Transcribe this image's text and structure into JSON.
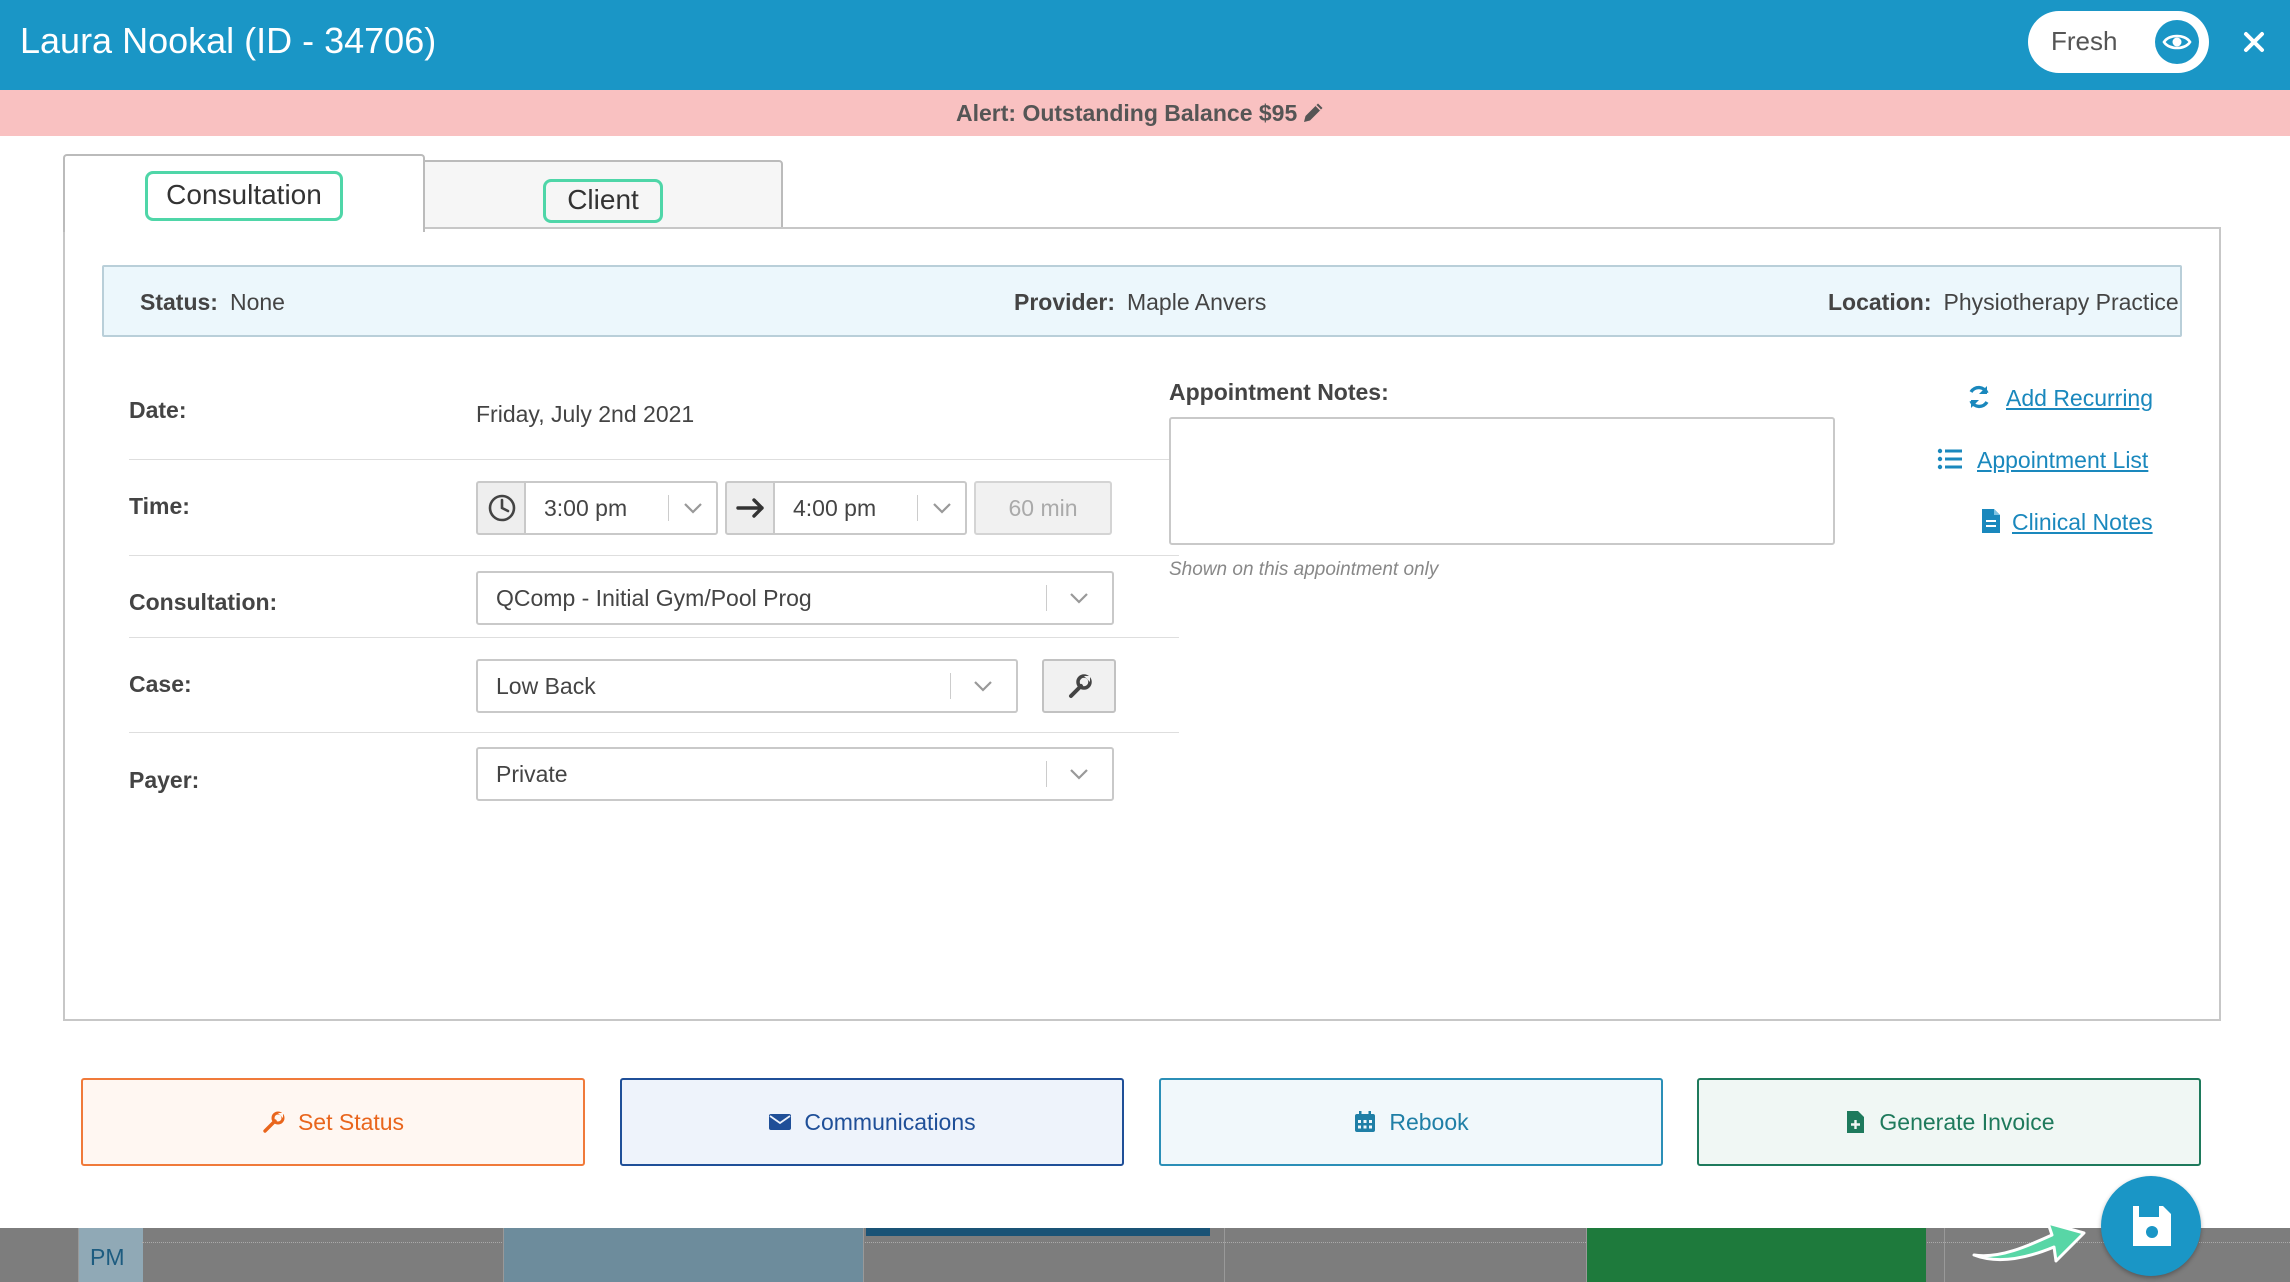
{
  "header": {
    "title": "Laura Nookal (ID - 34706)",
    "theme_label": "Fresh",
    "eye_icon": "eye-icon",
    "close_icon": "close-icon",
    "color": "#1a96c6"
  },
  "alert": {
    "text": "Alert: Outstanding Balance $95",
    "icon": "pencil-icon",
    "color": "#f9c1c1"
  },
  "tabs": [
    {
      "label": "Consultation",
      "active": true
    },
    {
      "label": "Client",
      "active": false
    }
  ],
  "info": {
    "status_label": "Status:",
    "status_value": "None",
    "provider_label": "Provider:",
    "provider_value": "Maple Anvers",
    "location_label": "Location:",
    "location_value": "Physiotherapy Practice"
  },
  "form": {
    "date_label": "Date:",
    "date_value": "Friday, July 2nd 2021",
    "time_label": "Time:",
    "start_time": "3:00 pm",
    "end_time": "4:00 pm",
    "duration": "60 min",
    "consultation_label": "Consultation:",
    "consultation_value": "QComp - Initial Gym/Pool Prog",
    "case_label": "Case:",
    "case_value": "Low Back",
    "payer_label": "Payer:",
    "payer_value": "Private"
  },
  "notes": {
    "label": "Appointment Notes:",
    "value": "",
    "hint": "Shown on this appointment only"
  },
  "side_links": [
    {
      "label": "Add Recurring",
      "icon": "refresh-icon"
    },
    {
      "label": "Appointment List",
      "icon": "list-icon"
    },
    {
      "label": "Clinical Notes",
      "icon": "document-icon"
    }
  ],
  "actions": {
    "set_status": "Set Status",
    "communications": "Communications",
    "rebook": "Rebook",
    "generate_invoice": "Generate Invoice"
  },
  "calendar": {
    "hour_label": "PM"
  },
  "save_icon": "floppy-disk-icon"
}
